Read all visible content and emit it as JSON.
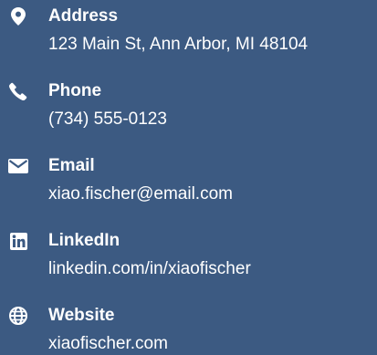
{
  "contacts": [
    {
      "label": "Address",
      "value": "123 Main St, Ann Arbor, MI 48104",
      "icon": "map-marker-icon"
    },
    {
      "label": "Phone",
      "value": "(734) 555-0123",
      "icon": "phone-icon"
    },
    {
      "label": "Email",
      "value": "xiao.fischer@email.com",
      "icon": "envelope-icon"
    },
    {
      "label": "LinkedIn",
      "value": "linkedin.com/in/xiaofischer",
      "icon": "linkedin-icon"
    },
    {
      "label": "Website",
      "value": "xiaofischer.com",
      "icon": "globe-icon"
    }
  ],
  "colors": {
    "background": "#3c5a82",
    "text": "#ffffff"
  }
}
